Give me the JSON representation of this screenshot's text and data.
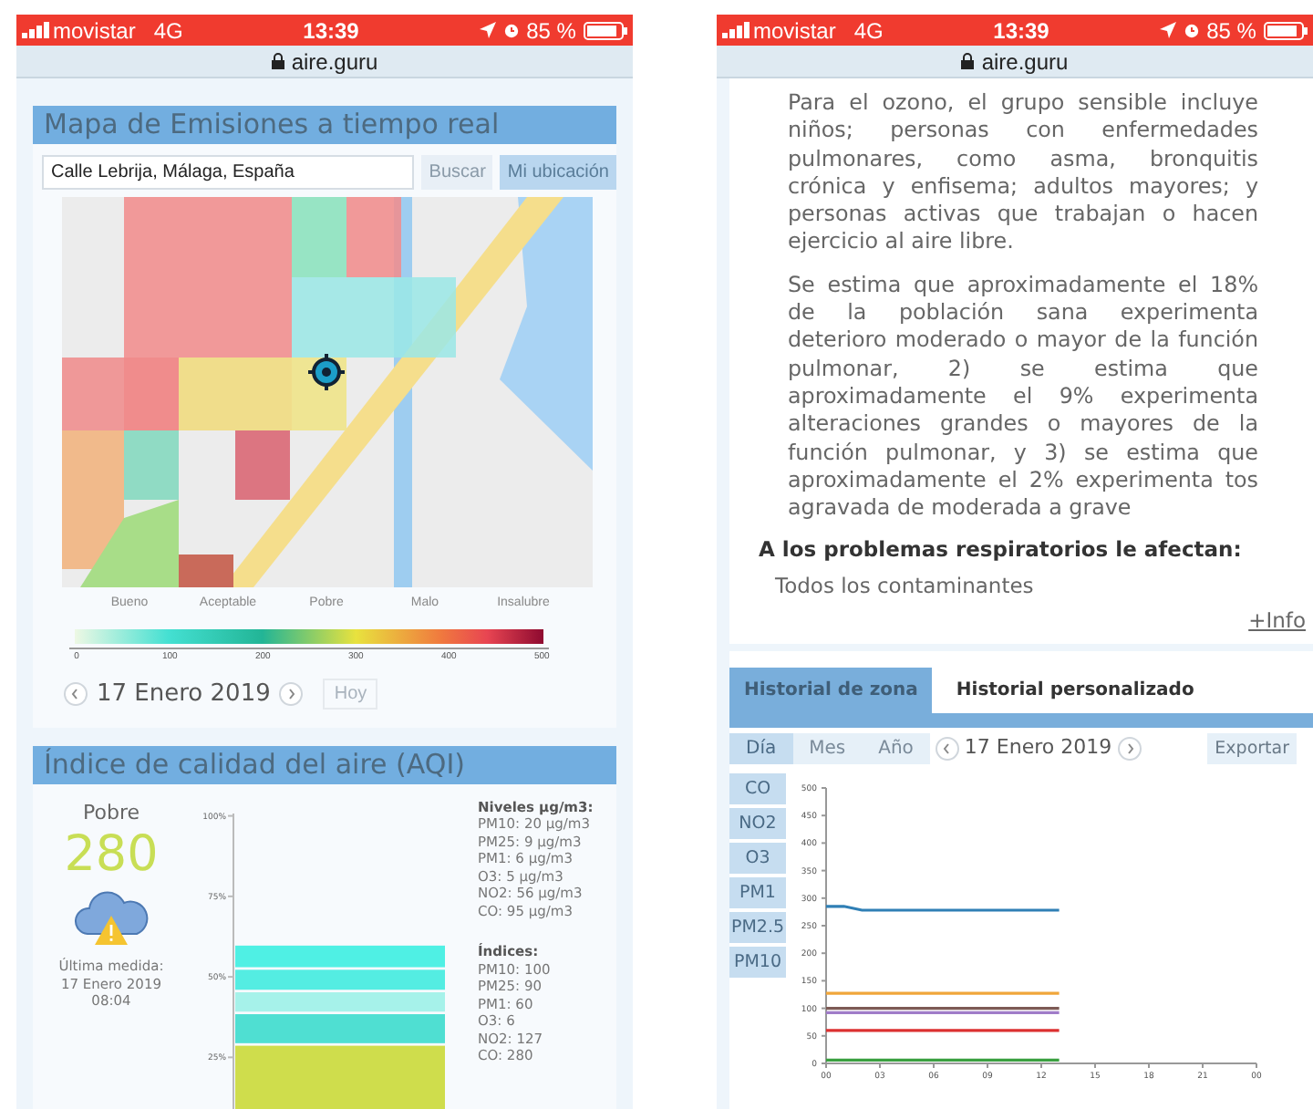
{
  "left_phone": {
    "status_bar": {
      "carrier": "movistar",
      "network": "4G",
      "time": "13:39",
      "battery": "85 %"
    },
    "address_bar": {
      "url": "aire.guru"
    },
    "map_card": {
      "title": "Mapa de Emisiones a tiempo real",
      "search": {
        "value": "Calle Lebrija, Málaga, España"
      },
      "buttons": [
        {
          "label": "Buscar",
          "kind": "plain"
        },
        {
          "label": "Mi ubicación",
          "kind": "primary"
        }
      ],
      "legend": {
        "labels": [
          "Bueno",
          "Aceptable",
          "Pobre",
          "Malo",
          "Insalubre"
        ],
        "ticks": [
          "0",
          "100",
          "200",
          "300",
          "400",
          "500"
        ]
      },
      "date_nav": {
        "date": "17 Enero 2019",
        "today_button": {
          "label": "Hoy",
          "disabled": true
        }
      }
    },
    "aqi_card": {
      "title": "Índice de calidad del aire (AQI)",
      "category": "Pobre",
      "value": "280",
      "last_measure": [
        "Última medida:",
        "17 Enero 2019",
        "08:04"
      ],
      "chart_data": {
        "type": "bar",
        "stacked": true,
        "ylim": [
          0,
          100
        ],
        "yticks": [
          {
            "value": 25,
            "label": "25%"
          },
          {
            "value": 50,
            "label": "50%"
          },
          {
            "value": 75,
            "label": "75%"
          },
          {
            "value": 100,
            "label": "100%"
          }
        ],
        "series": [
          {
            "color": "#cfdd4c",
            "values": [
              29
            ]
          },
          {
            "color": "#4fdfd2",
            "values": [
              9.8
            ]
          },
          {
            "color": "#a6f2ea",
            "values": [
              6.8
            ]
          },
          {
            "color": "#54ede2",
            "values": [
              7
            ]
          },
          {
            "color": "#4ff0e4",
            "values": [
              7.5
            ]
          }
        ]
      },
      "levels_title": "Niveles µg/m3:",
      "levels": [
        "PM10: 20 µg/m3",
        "PM25: 9 µg/m3",
        "PM1: 6 µg/m3",
        "O3: 5 µg/m3",
        "NO2: 56 µg/m3",
        "CO: 95 µg/m3"
      ],
      "indices_title": "Índices:",
      "indices": [
        "PM10: 100",
        "PM25: 90",
        "PM1: 60",
        "O3: 6",
        "NO2: 127",
        "CO: 280"
      ]
    }
  },
  "right_phone": {
    "status_bar": {
      "carrier": "movistar",
      "network": "4G",
      "time": "13:39",
      "battery": "85 %"
    },
    "address_bar": {
      "url": "aire.guru"
    },
    "paragraphs": [
      "Para el ozono, el grupo sensible incluye niños; personas con enfermedades pulmonares, como asma, bronquitis crónica y enfisema; adultos mayores; y personas activas que trabajan o hacen ejercicio al aire libre.",
      "Se estima que aproximadamente el 18% de la población sana experimenta deterioro moderado o mayor de la función pulmonar, 2) se estima que aproximadamente el 9% experimenta alteraciones grandes o mayores de la función pulmonar, y 3) se estima que aproximadamente el 2% experimenta tos agravada de moderada a grave"
    ],
    "heading": "A los problemas respiratorios le afectan:",
    "affected": "Todos los contaminantes",
    "more_link": "+Info",
    "tabs": [
      {
        "label": "Historial de zona",
        "selected": true
      },
      {
        "label": "Historial personalizado",
        "selected": false
      }
    ],
    "periods": [
      {
        "label": "Día",
        "selected": true
      },
      {
        "label": "Mes",
        "selected": false
      },
      {
        "label": "Año",
        "selected": false
      }
    ],
    "date": "17 Enero 2019",
    "export_button": "Exportar",
    "pollutants": [
      "CO",
      "NO2",
      "O3",
      "PM1",
      "PM2.5",
      "PM10"
    ],
    "chart_data": {
      "type": "line",
      "x": [
        0,
        1,
        2,
        3,
        4,
        5,
        6,
        7,
        8,
        9,
        10,
        11,
        12,
        13
      ],
      "xlim": [
        0,
        24
      ],
      "ylim": [
        0,
        500
      ],
      "xticks": [
        {
          "value": 0,
          "label": "00"
        },
        {
          "value": 3,
          "label": "03"
        },
        {
          "value": 6,
          "label": "06"
        },
        {
          "value": 9,
          "label": "09"
        },
        {
          "value": 12,
          "label": "12"
        },
        {
          "value": 15,
          "label": "15"
        },
        {
          "value": 18,
          "label": "18"
        },
        {
          "value": 21,
          "label": "21"
        },
        {
          "value": 24,
          "label": "00"
        }
      ],
      "yticks": [
        0,
        50,
        100,
        150,
        200,
        250,
        300,
        350,
        400,
        450,
        500
      ],
      "series": [
        {
          "color": "#2f7fb5",
          "values": [
            285,
            285,
            278,
            278,
            278,
            278,
            278,
            278,
            278,
            278,
            278,
            278,
            278,
            278
          ]
        },
        {
          "color": "#f0a63a",
          "values": [
            127,
            127,
            127,
            127,
            127,
            127,
            127,
            127,
            127,
            127,
            127,
            127,
            127,
            127
          ]
        },
        {
          "color": "#7d5a55",
          "values": [
            100,
            100,
            100,
            100,
            100,
            100,
            100,
            100,
            100,
            100,
            100,
            100,
            100,
            100
          ]
        },
        {
          "color": "#a07cc8",
          "values": [
            92,
            92,
            92,
            92,
            92,
            92,
            92,
            92,
            92,
            92,
            92,
            92,
            92,
            92
          ]
        },
        {
          "color": "#dc3030",
          "values": [
            60,
            60,
            60,
            60,
            60,
            60,
            60,
            60,
            60,
            60,
            60,
            60,
            60,
            60
          ]
        },
        {
          "color": "#3aa040",
          "values": [
            6,
            6,
            6,
            6,
            6,
            6,
            6,
            6,
            6,
            6,
            6,
            6,
            6,
            6
          ]
        }
      ]
    }
  }
}
